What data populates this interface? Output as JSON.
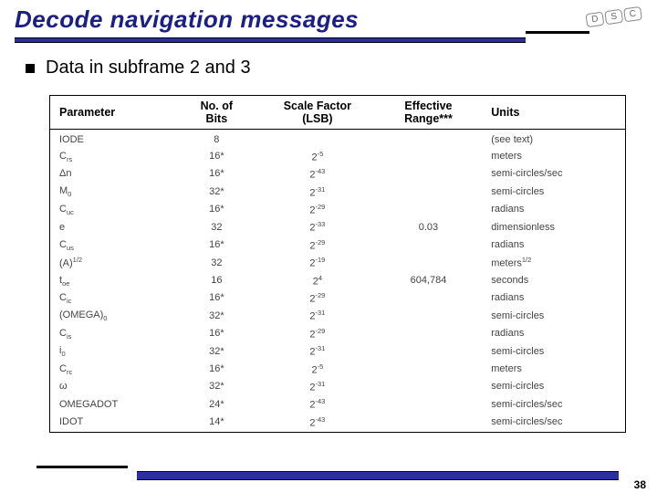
{
  "title": "Decode navigation messages",
  "bullet": "Data in subframe 2 and 3",
  "logo": {
    "a": "D",
    "b": "S",
    "c": "C"
  },
  "page_number": "38",
  "headers": {
    "param": "Parameter",
    "bits_l1": "No. of",
    "bits_l2": "Bits",
    "scale_l1": "Scale Factor",
    "scale_l2": "(LSB)",
    "range_l1": "Effective",
    "range_l2": "Range***",
    "units": "Units"
  },
  "rows": [
    {
      "param_html": "IODE",
      "bits": "8",
      "scale_html": "",
      "range": "",
      "units_html": "(see text)"
    },
    {
      "param_html": "C<span class='sub'>rs</span>",
      "bits": "16*",
      "scale_html": "2<span class='sup'>-5</span>",
      "range": "",
      "units_html": "meters"
    },
    {
      "param_html": "Δn",
      "bits": "16*",
      "scale_html": "2<span class='sup'>-43</span>",
      "range": "",
      "units_html": "semi-circles/sec"
    },
    {
      "param_html": "M<span class='sub'>0</span>",
      "bits": "32*",
      "scale_html": "2<span class='sup'>-31</span>",
      "range": "",
      "units_html": "semi-circles"
    },
    {
      "param_html": "C<span class='sub'>uc</span>",
      "bits": "16*",
      "scale_html": "2<span class='sup'>-29</span>",
      "range": "",
      "units_html": "radians"
    },
    {
      "param_html": "e",
      "bits": "32",
      "scale_html": "2<span class='sup'>-33</span>",
      "range": "0.03",
      "units_html": "dimensionless"
    },
    {
      "param_html": "C<span class='sub'>us</span>",
      "bits": "16*",
      "scale_html": "2<span class='sup'>-29</span>",
      "range": "",
      "units_html": "radians"
    },
    {
      "param_html": "(A)<span class='sup'>1/2</span>",
      "bits": "32",
      "scale_html": "2<span class='sup'>-19</span>",
      "range": "",
      "units_html": "meters<span class='sup'>1/2</span>"
    },
    {
      "param_html": "t<span class='sub'>oe</span>",
      "bits": "16",
      "scale_html": "2<span class='sup'>4</span>",
      "range": "604,784",
      "units_html": "seconds"
    },
    {
      "param_html": "C<span class='sub'>ic</span>",
      "bits": "16*",
      "scale_html": "2<span class='sup'>-29</span>",
      "range": "",
      "units_html": "radians"
    },
    {
      "param_html": "(OMEGA)<span class='sub'>0</span>",
      "bits": "32*",
      "scale_html": "2<span class='sup'>-31</span>",
      "range": "",
      "units_html": "semi-circles"
    },
    {
      "param_html": "C<span class='sub'>is</span>",
      "bits": "16*",
      "scale_html": "2<span class='sup'>-29</span>",
      "range": "",
      "units_html": "radians"
    },
    {
      "param_html": "i<span class='sub'>0</span>",
      "bits": "32*",
      "scale_html": "2<span class='sup'>-31</span>",
      "range": "",
      "units_html": "semi-circles"
    },
    {
      "param_html": "C<span class='sub'>rc</span>",
      "bits": "16*",
      "scale_html": "2<span class='sup'>-5</span>",
      "range": "",
      "units_html": "meters"
    },
    {
      "param_html": "ω",
      "bits": "32*",
      "scale_html": "2<span class='sup'>-31</span>",
      "range": "",
      "units_html": "semi-circles"
    },
    {
      "param_html": "OMEGADOT",
      "bits": "24*",
      "scale_html": "2<span class='sup'>-43</span>",
      "range": "",
      "units_html": "semi-circles/sec"
    },
    {
      "param_html": "IDOT",
      "bits": "14*",
      "scale_html": "2<span class='sup'>-43</span>",
      "range": "",
      "units_html": "semi-circles/sec"
    }
  ]
}
